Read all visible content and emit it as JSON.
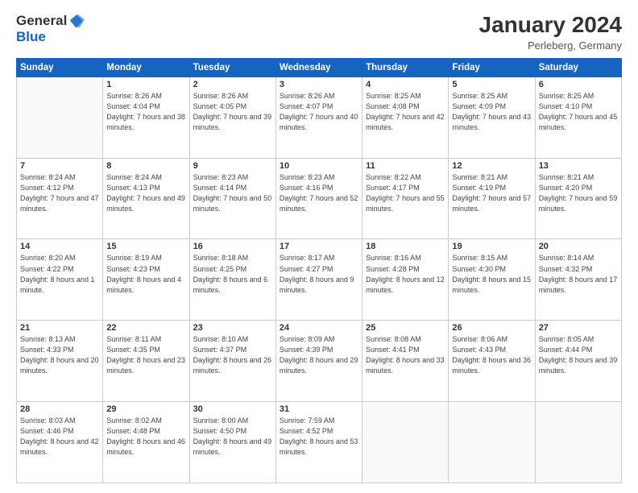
{
  "logo": {
    "general": "General",
    "blue": "Blue"
  },
  "title": "January 2024",
  "location": "Perleberg, Germany",
  "days_of_week": [
    "Sunday",
    "Monday",
    "Tuesday",
    "Wednesday",
    "Thursday",
    "Friday",
    "Saturday"
  ],
  "weeks": [
    [
      {
        "day": "",
        "sunrise": "",
        "sunset": "",
        "daylight": ""
      },
      {
        "day": "1",
        "sunrise": "Sunrise: 8:26 AM",
        "sunset": "Sunset: 4:04 PM",
        "daylight": "Daylight: 7 hours and 38 minutes."
      },
      {
        "day": "2",
        "sunrise": "Sunrise: 8:26 AM",
        "sunset": "Sunset: 4:05 PM",
        "daylight": "Daylight: 7 hours and 39 minutes."
      },
      {
        "day": "3",
        "sunrise": "Sunrise: 8:26 AM",
        "sunset": "Sunset: 4:07 PM",
        "daylight": "Daylight: 7 hours and 40 minutes."
      },
      {
        "day": "4",
        "sunrise": "Sunrise: 8:25 AM",
        "sunset": "Sunset: 4:08 PM",
        "daylight": "Daylight: 7 hours and 42 minutes."
      },
      {
        "day": "5",
        "sunrise": "Sunrise: 8:25 AM",
        "sunset": "Sunset: 4:09 PM",
        "daylight": "Daylight: 7 hours and 43 minutes."
      },
      {
        "day": "6",
        "sunrise": "Sunrise: 8:25 AM",
        "sunset": "Sunset: 4:10 PM",
        "daylight": "Daylight: 7 hours and 45 minutes."
      }
    ],
    [
      {
        "day": "7",
        "sunrise": "Sunrise: 8:24 AM",
        "sunset": "Sunset: 4:12 PM",
        "daylight": "Daylight: 7 hours and 47 minutes."
      },
      {
        "day": "8",
        "sunrise": "Sunrise: 8:24 AM",
        "sunset": "Sunset: 4:13 PM",
        "daylight": "Daylight: 7 hours and 49 minutes."
      },
      {
        "day": "9",
        "sunrise": "Sunrise: 8:23 AM",
        "sunset": "Sunset: 4:14 PM",
        "daylight": "Daylight: 7 hours and 50 minutes."
      },
      {
        "day": "10",
        "sunrise": "Sunrise: 8:23 AM",
        "sunset": "Sunset: 4:16 PM",
        "daylight": "Daylight: 7 hours and 52 minutes."
      },
      {
        "day": "11",
        "sunrise": "Sunrise: 8:22 AM",
        "sunset": "Sunset: 4:17 PM",
        "daylight": "Daylight: 7 hours and 55 minutes."
      },
      {
        "day": "12",
        "sunrise": "Sunrise: 8:21 AM",
        "sunset": "Sunset: 4:19 PM",
        "daylight": "Daylight: 7 hours and 57 minutes."
      },
      {
        "day": "13",
        "sunrise": "Sunrise: 8:21 AM",
        "sunset": "Sunset: 4:20 PM",
        "daylight": "Daylight: 7 hours and 59 minutes."
      }
    ],
    [
      {
        "day": "14",
        "sunrise": "Sunrise: 8:20 AM",
        "sunset": "Sunset: 4:22 PM",
        "daylight": "Daylight: 8 hours and 1 minute."
      },
      {
        "day": "15",
        "sunrise": "Sunrise: 8:19 AM",
        "sunset": "Sunset: 4:23 PM",
        "daylight": "Daylight: 8 hours and 4 minutes."
      },
      {
        "day": "16",
        "sunrise": "Sunrise: 8:18 AM",
        "sunset": "Sunset: 4:25 PM",
        "daylight": "Daylight: 8 hours and 6 minutes."
      },
      {
        "day": "17",
        "sunrise": "Sunrise: 8:17 AM",
        "sunset": "Sunset: 4:27 PM",
        "daylight": "Daylight: 8 hours and 9 minutes."
      },
      {
        "day": "18",
        "sunrise": "Sunrise: 8:16 AM",
        "sunset": "Sunset: 4:28 PM",
        "daylight": "Daylight: 8 hours and 12 minutes."
      },
      {
        "day": "19",
        "sunrise": "Sunrise: 8:15 AM",
        "sunset": "Sunset: 4:30 PM",
        "daylight": "Daylight: 8 hours and 15 minutes."
      },
      {
        "day": "20",
        "sunrise": "Sunrise: 8:14 AM",
        "sunset": "Sunset: 4:32 PM",
        "daylight": "Daylight: 8 hours and 17 minutes."
      }
    ],
    [
      {
        "day": "21",
        "sunrise": "Sunrise: 8:13 AM",
        "sunset": "Sunset: 4:33 PM",
        "daylight": "Daylight: 8 hours and 20 minutes."
      },
      {
        "day": "22",
        "sunrise": "Sunrise: 8:11 AM",
        "sunset": "Sunset: 4:35 PM",
        "daylight": "Daylight: 8 hours and 23 minutes."
      },
      {
        "day": "23",
        "sunrise": "Sunrise: 8:10 AM",
        "sunset": "Sunset: 4:37 PM",
        "daylight": "Daylight: 8 hours and 26 minutes."
      },
      {
        "day": "24",
        "sunrise": "Sunrise: 8:09 AM",
        "sunset": "Sunset: 4:39 PM",
        "daylight": "Daylight: 8 hours and 29 minutes."
      },
      {
        "day": "25",
        "sunrise": "Sunrise: 8:08 AM",
        "sunset": "Sunset: 4:41 PM",
        "daylight": "Daylight: 8 hours and 33 minutes."
      },
      {
        "day": "26",
        "sunrise": "Sunrise: 8:06 AM",
        "sunset": "Sunset: 4:43 PM",
        "daylight": "Daylight: 8 hours and 36 minutes."
      },
      {
        "day": "27",
        "sunrise": "Sunrise: 8:05 AM",
        "sunset": "Sunset: 4:44 PM",
        "daylight": "Daylight: 8 hours and 39 minutes."
      }
    ],
    [
      {
        "day": "28",
        "sunrise": "Sunrise: 8:03 AM",
        "sunset": "Sunset: 4:46 PM",
        "daylight": "Daylight: 8 hours and 42 minutes."
      },
      {
        "day": "29",
        "sunrise": "Sunrise: 8:02 AM",
        "sunset": "Sunset: 4:48 PM",
        "daylight": "Daylight: 8 hours and 46 minutes."
      },
      {
        "day": "30",
        "sunrise": "Sunrise: 8:00 AM",
        "sunset": "Sunset: 4:50 PM",
        "daylight": "Daylight: 8 hours and 49 minutes."
      },
      {
        "day": "31",
        "sunrise": "Sunrise: 7:59 AM",
        "sunset": "Sunset: 4:52 PM",
        "daylight": "Daylight: 8 hours and 53 minutes."
      },
      {
        "day": "",
        "sunrise": "",
        "sunset": "",
        "daylight": ""
      },
      {
        "day": "",
        "sunrise": "",
        "sunset": "",
        "daylight": ""
      },
      {
        "day": "",
        "sunrise": "",
        "sunset": "",
        "daylight": ""
      }
    ]
  ]
}
